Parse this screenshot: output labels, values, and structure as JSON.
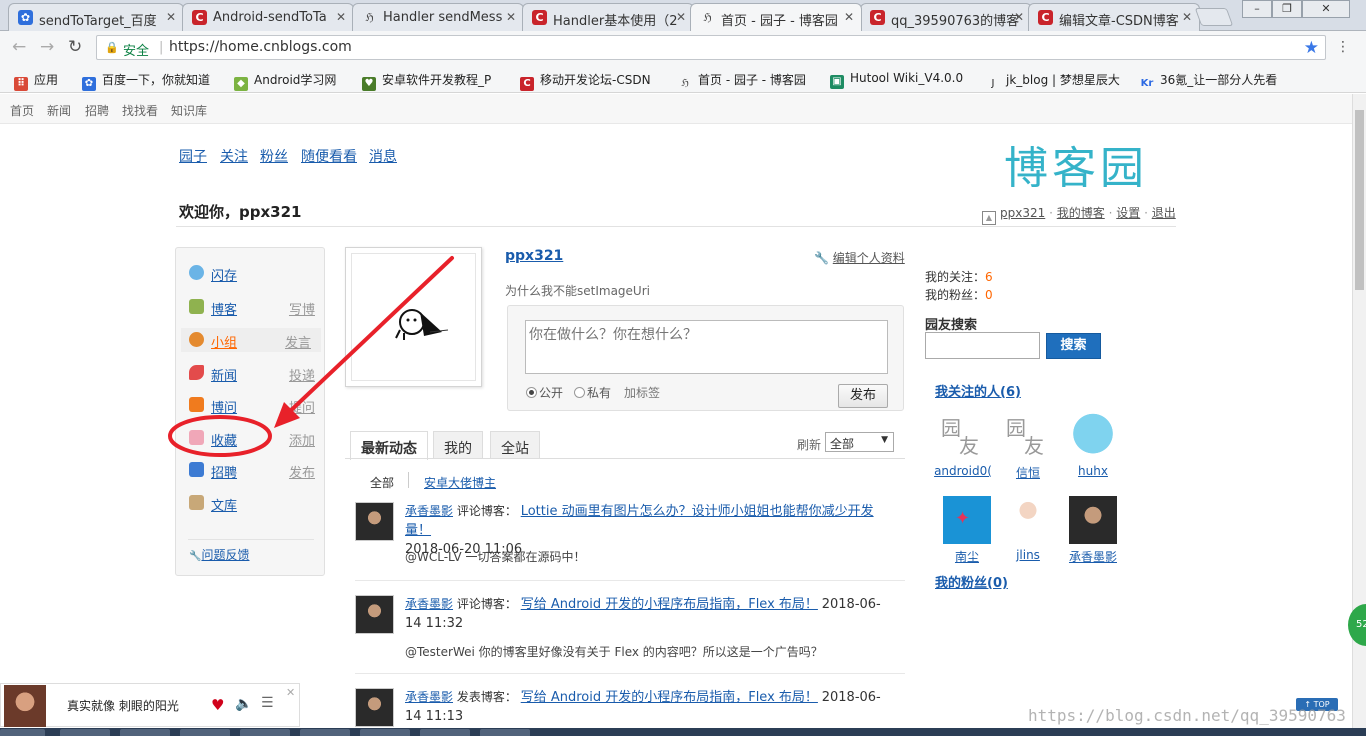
{
  "browser": {
    "tabs": [
      {
        "label": "sendToTarget_百度",
        "fav": "baidu-paw"
      },
      {
        "label": "Android-sendToTa",
        "fav": "csdn-c"
      },
      {
        "label": "Handler sendMess",
        "fav": "cnblogs"
      },
      {
        "label": "Handler基本使用（2",
        "fav": "csdn-c"
      },
      {
        "label": "首页 - 园子 - 博客园",
        "fav": "cnblogs",
        "active": true
      },
      {
        "label": "qq_39590763的博客",
        "fav": "csdn-c"
      },
      {
        "label": "编辑文章-CSDN博客",
        "fav": "csdn-c"
      }
    ],
    "secure_label": "安全",
    "url": "https://home.cnblogs.com",
    "bookmarks": [
      "应用",
      "百度一下，你就知道",
      "Android学习网",
      "安卓软件开发教程_P",
      "移动开发论坛-CSDN",
      "首页 - 园子 - 博客园",
      "Hutool Wiki_V4.0.0",
      "jk_blog | 梦想星辰大",
      "36氪_让一部分人先看"
    ]
  },
  "site_nav": [
    "首页",
    "新闻",
    "招聘",
    "找找看",
    "知识库"
  ],
  "sub_nav": [
    "园子",
    "关注",
    "粉丝",
    "随便看看",
    "消息"
  ],
  "logo_text": "博客园",
  "welcome": "欢迎你，ppx321",
  "user_links": {
    "user": "ppx321",
    "my_blog": "我的博客",
    "settings": "设置",
    "logout": "退出",
    "dot": "·"
  },
  "sidebar": {
    "items": [
      {
        "label": "闪存",
        "sub": ""
      },
      {
        "label": "博客",
        "sub": "写博"
      },
      {
        "label": "小组",
        "sub": "发言"
      },
      {
        "label": "新闻",
        "sub": "投递"
      },
      {
        "label": "博问",
        "sub": "提问"
      },
      {
        "label": "收藏",
        "sub": "添加"
      },
      {
        "label": "招聘",
        "sub": "发布"
      },
      {
        "label": "文库",
        "sub": ""
      }
    ],
    "feedback": "问题反馈"
  },
  "profile": {
    "name": "ppx321",
    "edit": "编辑个人资料",
    "signature": "为什么我不能setImageUri",
    "status_placeholder": "你在做什么？你在想什么？",
    "public_label": "公开",
    "private_label": "私有",
    "tag_label": "加标签",
    "publish": "发布"
  },
  "feed_tabs": [
    "最新动态",
    "我的",
    "全站"
  ],
  "refresh_label": "刷新",
  "filter_value": "全部",
  "sub_filter": {
    "all": "全部",
    "link": "安卓大佬博主"
  },
  "feed": [
    {
      "who": "承香墨影",
      "action": "评论博客：",
      "title": "Lottie 动画里有图片怎么办？设计师小姐姐也能帮你减少开发量！",
      "date": "2018-06-20 11:06",
      "content": "@WCL-LV 一切答案都在源码中！"
    },
    {
      "who": "承香墨影",
      "action": "评论博客：",
      "title": "写给 Android 开发的小程序布局指南，Flex 布局！",
      "date": "2018-06-14 11:32",
      "content": "@TesterWei 你的博客里好像没有关于 Flex 的内容吧？所以这是一个广告吗？"
    },
    {
      "who": "承香墨影",
      "action": "发表博客：",
      "title": "写给 Android 开发的小程序布局指南，Flex 布局！",
      "date": "2018-06-14 11:13",
      "content": ""
    }
  ],
  "right": {
    "following_label": "我的关注：",
    "following_count": "6",
    "fans_label": "我的粉丝：",
    "fans_count": "0",
    "search_title": "园友搜索",
    "search_button": "搜索",
    "following_section": "我关注的人(6)",
    "fans_section": "我的粉丝(0)",
    "following_users": [
      "android0(",
      "信恒",
      "huhx",
      "南尘",
      "jlins",
      "承香墨影"
    ]
  },
  "music": {
    "song": "真实就像 刺眼的阳光"
  },
  "top_button": "↑ TOP",
  "badge": "52",
  "watermark": "https://blog.csdn.net/qq_39590763",
  "colors": {
    "link": "#1a5cac",
    "accent": "#f60",
    "search_btn": "#1f6fbd",
    "logo": "#35b3c9",
    "arrow": "#e8212a"
  }
}
